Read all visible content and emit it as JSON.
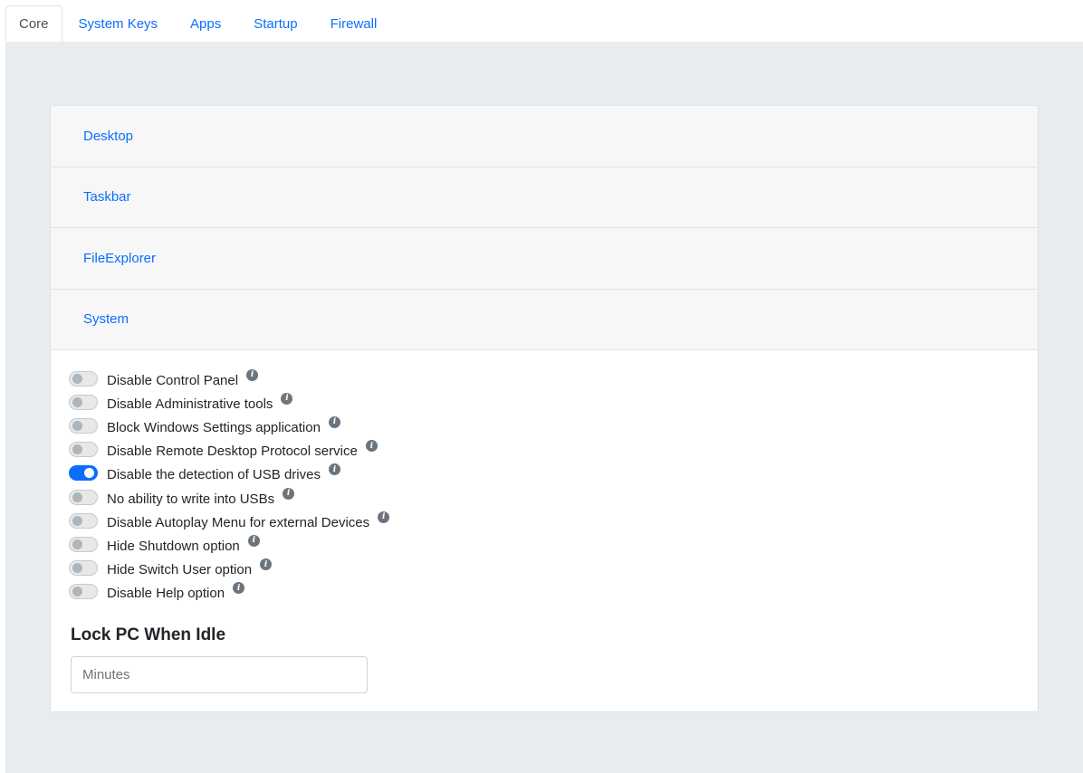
{
  "tabs": [
    {
      "label": "Core",
      "active": true
    },
    {
      "label": "System Keys",
      "active": false
    },
    {
      "label": "Apps",
      "active": false
    },
    {
      "label": "Startup",
      "active": false
    },
    {
      "label": "Firewall",
      "active": false
    }
  ],
  "accordion": {
    "sections": [
      {
        "label": "Desktop"
      },
      {
        "label": "Taskbar"
      },
      {
        "label": "FileExplorer"
      },
      {
        "label": "System",
        "expanded": true
      }
    ]
  },
  "system": {
    "options": [
      {
        "label": "Disable Control Panel",
        "enabled": false
      },
      {
        "label": "Disable Administrative tools",
        "enabled": false
      },
      {
        "label": "Block Windows Settings application",
        "enabled": false
      },
      {
        "label": "Disable Remote Desktop Protocol service",
        "enabled": false
      },
      {
        "label": "Disable the detection of USB drives",
        "enabled": true
      },
      {
        "label": "No ability to write into USBs",
        "enabled": false
      },
      {
        "label": "Disable Autoplay Menu for external Devices",
        "enabled": false
      },
      {
        "label": "Hide Shutdown option",
        "enabled": false
      },
      {
        "label": "Hide Switch User option",
        "enabled": false
      },
      {
        "label": "Disable Help option",
        "enabled": false
      }
    ],
    "info_icon": "info-circle-icon",
    "info_glyph": "i"
  },
  "lock_idle": {
    "title": "Lock PC When Idle",
    "value": "",
    "placeholder": "Minutes"
  },
  "colors": {
    "accent": "#0d6efd",
    "background": "#e9ecef",
    "header_bg": "#f7f7f7"
  }
}
